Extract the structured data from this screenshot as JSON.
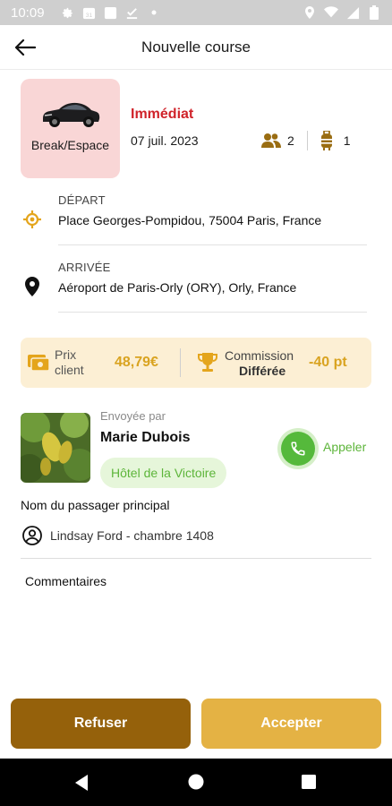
{
  "status_bar": {
    "time": "10:09",
    "left_icons": [
      "gear-icon",
      "calendar-icon",
      "square-icon",
      "download-done-icon",
      "dot-icon"
    ],
    "right_icons": [
      "location-icon",
      "wifi-icon",
      "signal-icon",
      "battery-icon"
    ]
  },
  "header": {
    "title": "Nouvelle course",
    "back_icon": "arrow-left-icon"
  },
  "ride": {
    "vehicle_type": "Break/Espace",
    "timing": "Immédiat",
    "date": "07 juil. 2023",
    "passengers": "2",
    "luggage": "1",
    "timing_color": "#d0232a",
    "vehicle_bg": "#f9d6d6"
  },
  "departure": {
    "label": "DÉPART",
    "address": "Place Georges-Pompidou, 75004 Paris, France",
    "icon": "gps-target-icon"
  },
  "arrival": {
    "label": "ARRIVÉE",
    "address": "Aéroport de Paris-Orly (ORY), Orly, France",
    "icon": "map-pin-icon"
  },
  "pricing": {
    "price_label_line1": "Prix",
    "price_label_line2": "client",
    "price_value": "48,79€",
    "commission_label": "Commission",
    "commission_sub": "Différée",
    "commission_value": "-40 pt",
    "accent": "#d9a320",
    "background": "#fcefd4"
  },
  "sender": {
    "sent_by_label": "Envoyée par",
    "name": "Marie Dubois",
    "hotel": "Hôtel de la Victoire",
    "call_label": "Appeler"
  },
  "passenger": {
    "title": "Nom du passager principal",
    "name": "Lindsay Ford - chambre 1408"
  },
  "comments": {
    "title": "Commentaires"
  },
  "actions": {
    "refuse": "Refuser",
    "accept": "Accepter",
    "refuse_color": "#95610b",
    "accept_color": "#e4b244"
  }
}
